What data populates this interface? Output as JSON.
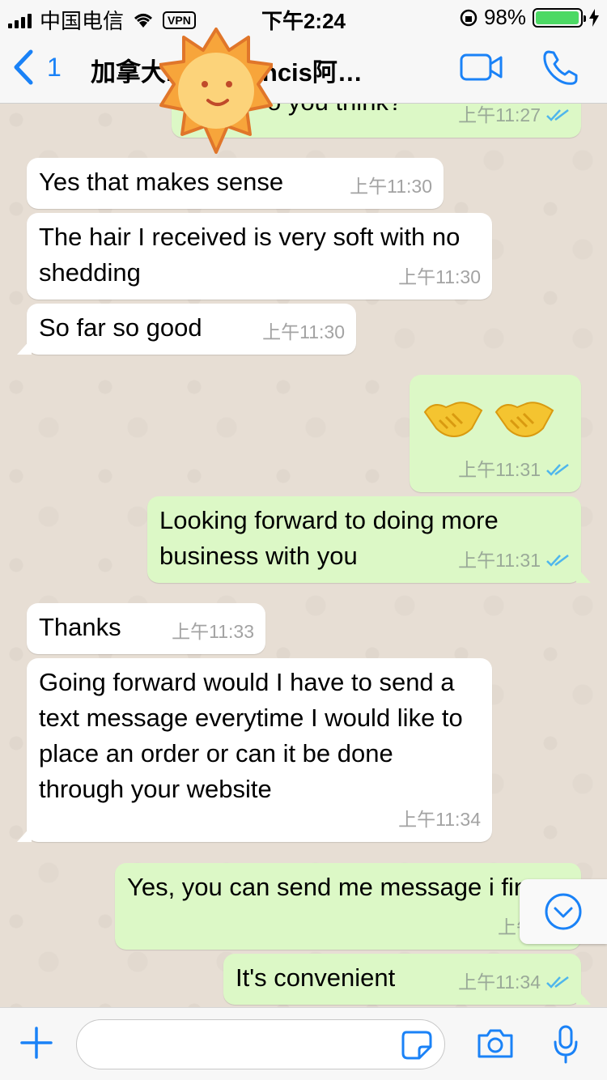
{
  "status_bar": {
    "carrier": "中国电信",
    "vpn": "VPN",
    "time": "下午2:24",
    "battery": "98%",
    "battery_level": 0.98
  },
  "header": {
    "back_count": "1",
    "title": "加拿大Lisa Francis阿…",
    "accent": "#1a82f7"
  },
  "messages": [
    {
      "side": "out",
      "text": "o you think?",
      "time": "上午11:27",
      "read": true
    },
    {
      "side": "in",
      "text": "Yes that makes sense",
      "time": "上午11:30"
    },
    {
      "side": "in",
      "text": "The hair I received is very soft with no shedding",
      "time": "上午11:30"
    },
    {
      "side": "in",
      "text": "So far so good",
      "time": "上午11:30"
    },
    {
      "side": "out",
      "text": "🤝 🤝",
      "time": "上午11:31",
      "read": true
    },
    {
      "side": "out",
      "text": "Looking forward to doing more business with you",
      "time": "上午11:31",
      "read": true
    },
    {
      "side": "in",
      "text": "Thanks",
      "time": "上午11:33"
    },
    {
      "side": "in",
      "text": "Going forward would I have to send a text message everytime I would like to place an order or can it be done through your website",
      "time": "上午11:34"
    },
    {
      "side": "out",
      "text": "Yes, you can send me message i fine",
      "time": "上午11:3",
      "read": true
    },
    {
      "side": "out",
      "text": "It's convenient",
      "time": "上午11:34",
      "read": true
    }
  ],
  "input": {
    "placeholder": ""
  },
  "icons": {
    "back": "chevron-left-icon",
    "video": "video-call-icon",
    "phone": "phone-call-icon",
    "scroll": "scroll-down-icon",
    "plus": "plus-icon",
    "sticker": "sticker-icon",
    "camera": "camera-icon",
    "mic": "microphone-icon"
  },
  "colors": {
    "chat_bg": "#e7ded4",
    "incoming_bubble": "#ffffff",
    "outgoing_bubble": "#dcf8c6",
    "read_ticks": "#4fb6ec"
  }
}
